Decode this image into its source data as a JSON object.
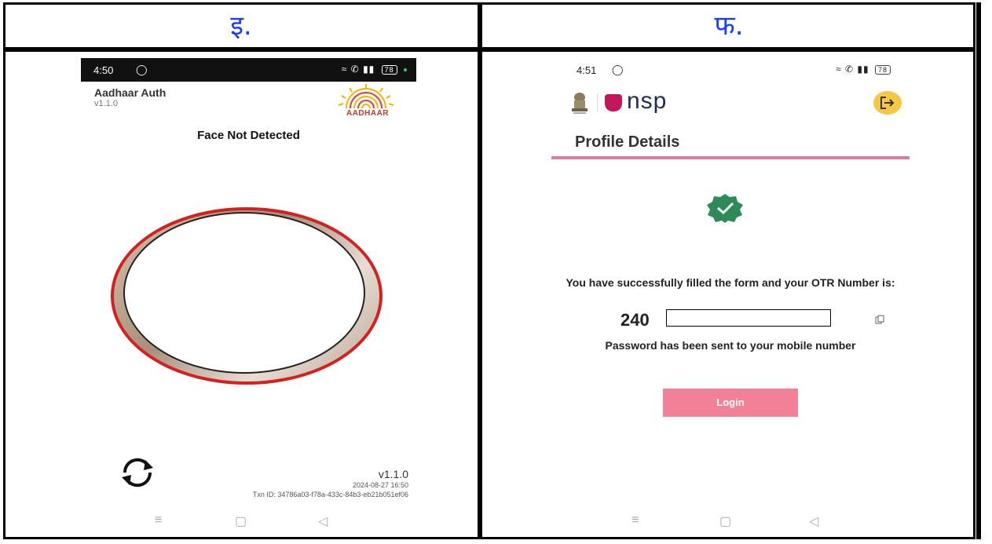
{
  "columns": {
    "left_label": "इ.",
    "right_label": "फ."
  },
  "left_phone": {
    "status_time": "4:50",
    "battery": "78",
    "app_title": "Aadhaar Auth",
    "app_version": "v1.1.0",
    "logo_text": "AADHAAR",
    "message": "Face Not Detected",
    "footer_version": "v1.1.0",
    "footer_datetime": "2024-08-27 16:50",
    "txn_id": "Txn ID: 34786a03-f78a-433c-84b3-eb21b051ef06"
  },
  "right_phone": {
    "status_time": "4:51",
    "battery": "78",
    "brand": "nsp",
    "page_title": "Profile Details",
    "success_message": "You have successfully filled the form and your OTR Number is:",
    "otr_prefix": "240",
    "password_message": "Password has been sent to your mobile number",
    "login_label": "Login"
  },
  "colors": {
    "label_blue": "#1a3cff",
    "ring_red": "#d62020",
    "nsp_pink": "#e17aa1",
    "login_pink": "#f28096",
    "logout_yellow": "#f4c842",
    "badge_green": "#2e8b57"
  }
}
